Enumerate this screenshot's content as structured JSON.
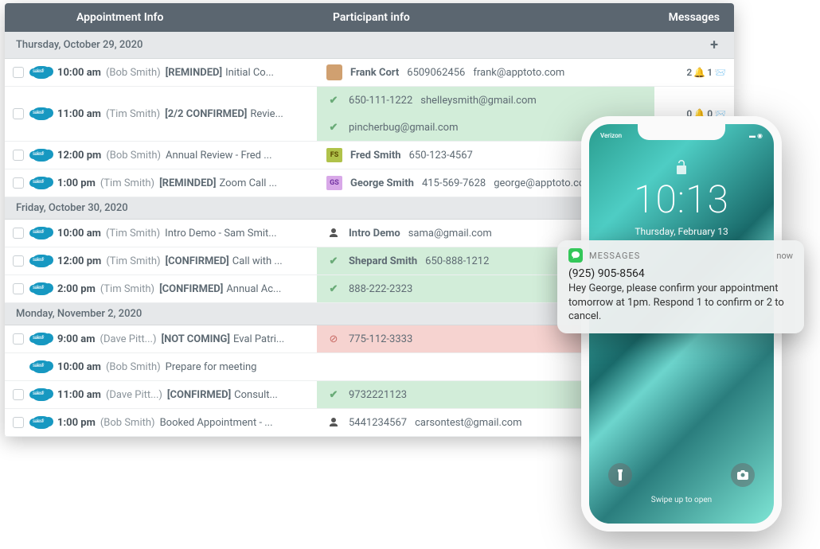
{
  "header": {
    "col_appt": "Appointment Info",
    "col_part": "Participant info",
    "col_msgs": "Messages"
  },
  "groups": [
    {
      "label": "Thursday, October 29, 2020",
      "show_plus": true,
      "rows": [
        {
          "time": "10:00 am",
          "owner": "(Bob Smith)",
          "tag": "[REMINDED]",
          "title": "Initial Co...",
          "participants": [
            {
              "icon_type": "avatar",
              "name": "Frank Cort",
              "phone": "6509062456",
              "email": "frank@apptoto.com",
              "status": ""
            }
          ],
          "msgs": {
            "bell": 2,
            "env": 1
          }
        },
        {
          "time": "11:00 am",
          "owner": "(Tim Smith)",
          "tag": "[2/2 CONFIRMED]",
          "title": "Revie...",
          "participants": [
            {
              "icon_type": "check",
              "name": "",
              "phone": "650-111-1222",
              "email": "shelleysmith@gmail.com",
              "status": "confirmed"
            },
            {
              "icon_type": "check",
              "name": "",
              "phone": "",
              "email": "pincherbug@gmail.com",
              "status": "confirmed"
            }
          ],
          "msgs": {
            "bell": 0,
            "env": 0
          }
        },
        {
          "time": "12:00 pm",
          "owner": "(Bob Smith)",
          "tag": "",
          "title": "Annual Review - Fred ...",
          "participants": [
            {
              "icon_type": "badge-fs",
              "initials": "FS",
              "name": "Fred Smith",
              "phone": "650-123-4567",
              "email": "",
              "status": ""
            }
          ]
        },
        {
          "time": "1:00 pm",
          "owner": "(Tim Smith)",
          "tag": "[REMINDED]",
          "title": "Zoom Call ...",
          "participants": [
            {
              "icon_type": "badge-gs",
              "initials": "GS",
              "name": "George Smith",
              "phone": "415-569-7628",
              "email": "george@apptoto.com",
              "status": ""
            }
          ]
        }
      ]
    },
    {
      "label": "Friday, October 30, 2020",
      "show_plus": false,
      "rows": [
        {
          "time": "10:00 am",
          "owner": "(Tim Smith)",
          "tag": "",
          "title": "Intro Demo - Sam Smit...",
          "participants": [
            {
              "icon_type": "person",
              "name": "Intro Demo",
              "phone": "",
              "email": "sama@gmail.com",
              "status": ""
            }
          ]
        },
        {
          "time": "12:00 pm",
          "owner": "(Tim Smith)",
          "tag": "[CONFIRMED]",
          "title": "Call with ...",
          "participants": [
            {
              "icon_type": "check",
              "name": "Shepard Smith",
              "phone": "650-888-1212",
              "email": "",
              "status": "confirmed"
            }
          ]
        },
        {
          "time": "2:00 pm",
          "owner": "(Tim Smith)",
          "tag": "[CONFIRMED]",
          "title": "Annual Ac...",
          "participants": [
            {
              "icon_type": "check",
              "name": "",
              "phone": "888-222-2323",
              "email": "",
              "status": "confirmed"
            }
          ]
        }
      ]
    },
    {
      "label": "Monday, November 2, 2020",
      "show_plus": false,
      "rows": [
        {
          "time": "9:00 am",
          "owner": "(Dave Pitt...)",
          "tag": "[NOT COMING]",
          "title": "Eval Patri...",
          "participants": [
            {
              "icon_type": "deny",
              "name": "",
              "phone": "775-112-3333",
              "email": "",
              "status": "denied"
            }
          ]
        },
        {
          "time": "10:00 am",
          "owner": "(Bob Smith)",
          "tag": "",
          "title": "Prepare for meeting",
          "no_checkbox": true,
          "participants": []
        },
        {
          "time": "11:00 am",
          "owner": "(Dave Pitt...)",
          "tag": "[CONFIRMED]",
          "title": "Consult...",
          "participants": [
            {
              "icon_type": "check",
              "name": "",
              "phone": "9732221123",
              "email": "",
              "status": "confirmed"
            }
          ]
        },
        {
          "time": "1:00 pm",
          "owner": "(Bob Smith)",
          "tag": "",
          "title": "Booked Appointment - ...",
          "participants": [
            {
              "icon_type": "person",
              "name": "",
              "phone": "5441234567",
              "email": "carsontest@gmail.com",
              "status": ""
            }
          ]
        }
      ]
    }
  ],
  "phone": {
    "carrier": "Verizon",
    "time": "10:13",
    "date": "Thursday, February 13",
    "swipe": "Swipe up to open"
  },
  "notification": {
    "app_label": "MESSAGES",
    "when": "now",
    "title": "(925) 905-8564",
    "body": "Hey George, please confirm your appointment tomorrow at 1pm. Respond 1 to confirm or 2 to cancel."
  },
  "sf_label": "salesforce"
}
